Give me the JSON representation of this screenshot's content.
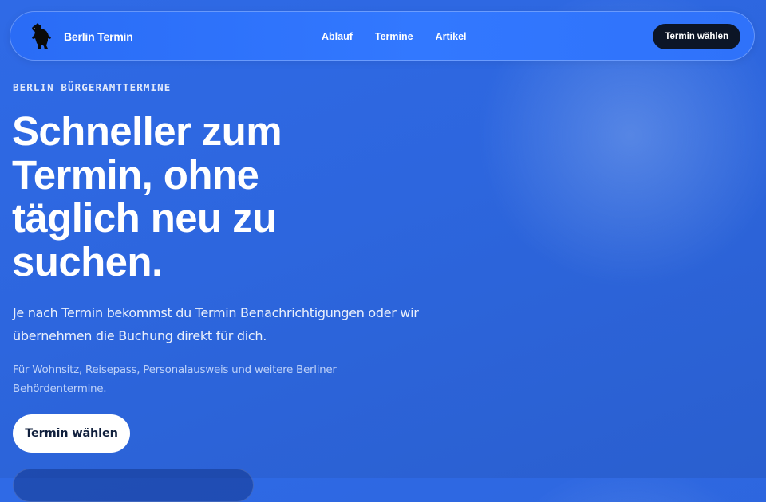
{
  "nav": {
    "brand": "Berlin Termin",
    "brand_icon": "berlin-bear-icon",
    "links": [
      "Ablauf",
      "Termine",
      "Artikel"
    ],
    "cta": "Termin wählen"
  },
  "hero": {
    "eyebrow": "BERLIN BÜRGERAMTTERMINE",
    "headline": "Schneller zum Termin, ohne täglich neu zu suchen.",
    "lead": "Je nach Termin bekommst du Termin Benachrichtigungen oder wir übernehmen die Buchung direkt für dich.",
    "subnote": "Für Wohnsitz, Reisepass, Personalausweis und weitere Berliner Behördentermine.",
    "cta": "Termin wählen"
  },
  "colors": {
    "background": "#2d66de",
    "nav_background": "#3278ff",
    "nav_cta": "#0c1526",
    "hero_cta": "#ffffff",
    "hero_cta_text": "#11203d"
  }
}
